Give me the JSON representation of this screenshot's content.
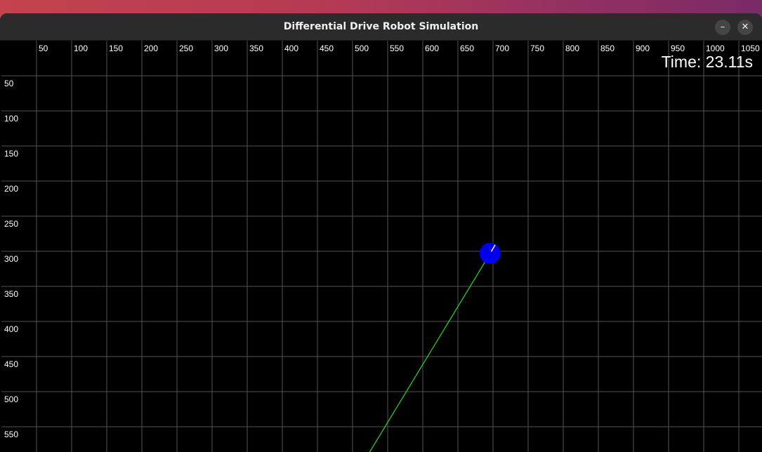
{
  "window": {
    "title": "Differential Drive Robot Simulation",
    "minimize_symbol": "–",
    "close_symbol": "✕"
  },
  "simulation": {
    "time_label": "Time: 23.11s",
    "x_ticks": [
      "50",
      "100",
      "150",
      "200",
      "250",
      "300",
      "350",
      "400",
      "450",
      "500",
      "550",
      "600",
      "650",
      "700",
      "750",
      "800",
      "850",
      "900",
      "950",
      "1000",
      "1050"
    ],
    "y_ticks": [
      "50",
      "100",
      "150",
      "200",
      "250",
      "300",
      "350",
      "400",
      "450",
      "500",
      "550"
    ],
    "robot": {
      "x": 696,
      "y": 303,
      "heading_deg": 60,
      "color": "#0000ee"
    },
    "trail": [
      [
        696,
        303
      ],
      [
        522,
        590
      ]
    ],
    "colors": {
      "background": "#000000",
      "grid": "#555555",
      "trail": "#22dd22",
      "heading": "#ffffff",
      "tick_text": "#ffffff"
    }
  }
}
